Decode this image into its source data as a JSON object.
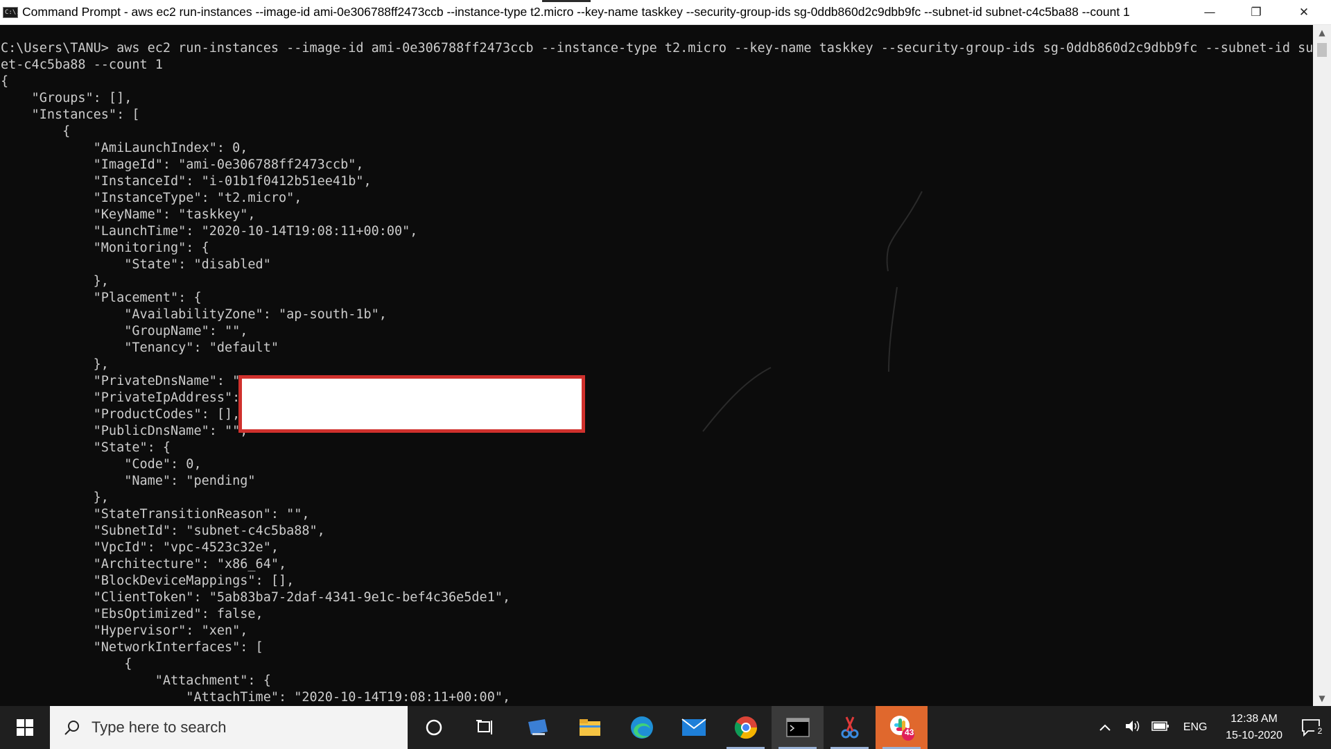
{
  "window": {
    "title": "Command Prompt - aws  ec2 run-instances --image-id ami-0e306788ff2473ccb --instance-type t2.micro --key-name taskkey --security-group-ids sg-0ddb860d2c9dbb9fc --subnet-id subnet-c4c5ba88 --count 1",
    "icon_label": "C:\\.",
    "minimize": "—",
    "restore": "❐",
    "close": "✕"
  },
  "console": {
    "lines": [
      "C:\\Users\\TANU> aws ec2 run-instances --image-id ami-0e306788ff2473ccb --instance-type t2.micro --key-name taskkey --security-group-ids sg-0ddb860d2c9dbb9fc --subnet-id subn",
      "et-c4c5ba88 --count 1",
      "{",
      "    \"Groups\": [],",
      "    \"Instances\": [",
      "        {",
      "            \"AmiLaunchIndex\": 0,",
      "            \"ImageId\": \"ami-0e306788ff2473ccb\",",
      "            \"InstanceId\": \"i-01b1f0412b51ee41b\",",
      "            \"InstanceType\": \"t2.micro\",",
      "            \"KeyName\": \"taskkey\",",
      "            \"LaunchTime\": \"2020-10-14T19:08:11+00:00\",",
      "            \"Monitoring\": {",
      "                \"State\": \"disabled\"",
      "            },",
      "            \"Placement\": {",
      "                \"AvailabilityZone\": \"ap-south-1b\",",
      "                \"GroupName\": \"\",",
      "                \"Tenancy\": \"default\"",
      "            },",
      "            \"PrivateDnsName\": \"",
      "            \"PrivateIpAddress\":",
      "            \"ProductCodes\": [],",
      "            \"PublicDnsName\": \"\",",
      "            \"State\": {",
      "                \"Code\": 0,",
      "                \"Name\": \"pending\"",
      "            },",
      "            \"StateTransitionReason\": \"\",",
      "            \"SubnetId\": \"subnet-c4c5ba88\",",
      "            \"VpcId\": \"vpc-4523c32e\",",
      "            \"Architecture\": \"x86_64\",",
      "            \"BlockDeviceMappings\": [],",
      "            \"ClientToken\": \"5ab83ba7-2daf-4341-9e1c-bef4c36e5de1\",",
      "            \"EbsOptimized\": false,",
      "            \"Hypervisor\": \"xen\",",
      "            \"NetworkInterfaces\": [",
      "                {",
      "                    \"Attachment\": {",
      "                        \"AttachTime\": \"2020-10-14T19:08:11+00:00\","
    ],
    "text_color": "#cccccc",
    "background": "#0c0c0c",
    "redaction_border_color": "#d0312d"
  },
  "taskbar": {
    "search_placeholder": "Type here to search",
    "icons": [
      "windows-start-icon",
      "search-icon",
      "cortana-icon",
      "task-view-icon",
      "desktop-icon",
      "file-explorer-icon",
      "edge-icon",
      "mail-icon",
      "chrome-icon",
      "command-prompt-icon",
      "snipping-tool-icon",
      "slack-icon"
    ],
    "slack_badge": "43",
    "tray": {
      "language": "ENG",
      "time": "12:38 AM",
      "date": "15-10-2020",
      "notification_count": "2"
    }
  }
}
